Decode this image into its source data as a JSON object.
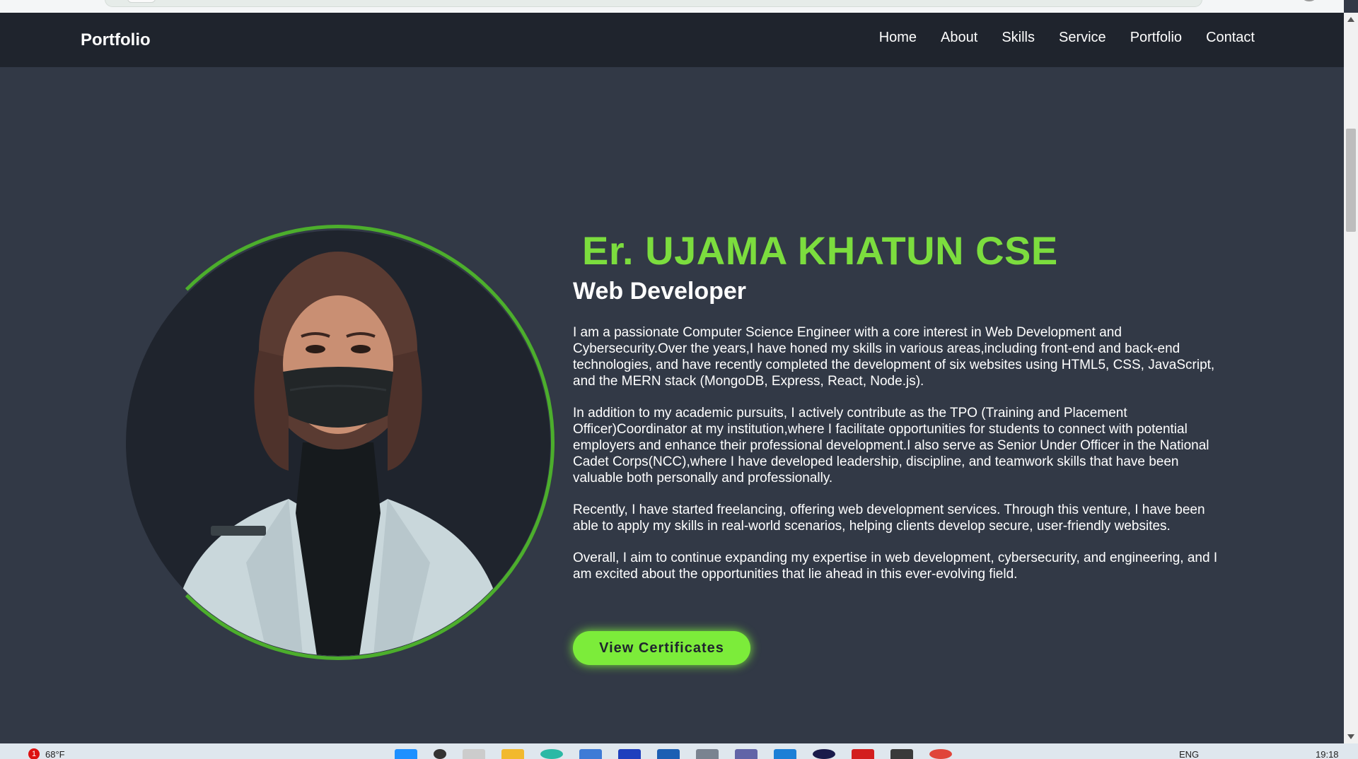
{
  "navbar": {
    "logo": "Portfolio",
    "links": [
      "Home",
      "About",
      "Skills",
      "Service",
      "Portfolio",
      "Contact"
    ]
  },
  "hero": {
    "name": "Er. UJAMA KHATUN CSE",
    "role": "Web Developer",
    "paragraphs": [
      "I am a passionate Computer Science Engineer with a core interest in Web Development and Cybersecurity.Over the years,I have honed my skills in various areas,including front-end and back-end technologies, and have recently completed the development of six websites using HTML5, CSS, JavaScript, and the MERN stack (MongoDB, Express, React, Node.js).",
      "In addition to my academic pursuits, I actively contribute as the TPO (Training and Placement Officer)Coordinator at my institution,where I facilitate opportunities for students to connect with potential employers and enhance their professional development.I also serve as Senior Under Officer in the National Cadet Corps(NCC),where I have developed leadership, discipline, and teamwork skills that have been valuable both personally and professionally.",
      "Recently, I have started freelancing, offering web development services. Through this venture, I have been able to apply my skills in real-world scenarios, helping clients develop secure, user-friendly websites.",
      "Overall, I aim to continue expanding my expertise in web development, cybersecurity, and engineering, and I am excited about the opportunities that lie ahead in this ever-evolving field."
    ],
    "button_label": "View Certificates"
  },
  "taskbar": {
    "weather_badge": "1",
    "temperature": "68°F",
    "language": "ENG",
    "time": "19:18"
  },
  "colors": {
    "accent": "#7cdd3e",
    "button": "#7cec3a",
    "background": "#323946",
    "navbar": "#1f242d"
  }
}
